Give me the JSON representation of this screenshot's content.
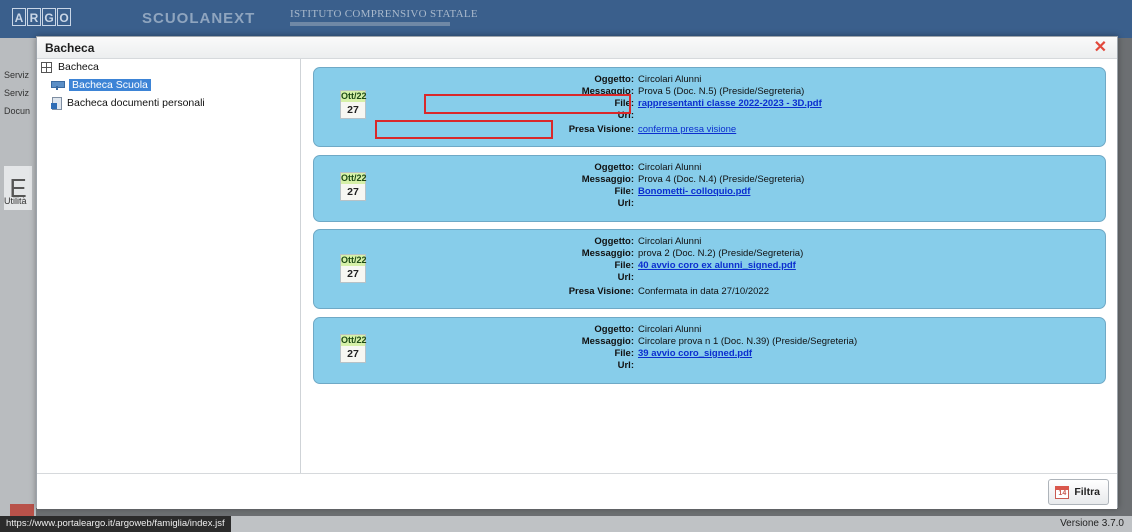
{
  "app": {
    "logo_letters": [
      "A",
      "R",
      "G",
      "O"
    ],
    "brand": "SCUOLANEXT",
    "school": "ISTITUTO COMPRENSIVO STATALE",
    "bg_menu": [
      "Serviz",
      "Serviz",
      "Docun",
      "Utilità"
    ],
    "bg_tile_letter": "E",
    "status_url": "https://www.portaleargo.it/argoweb/famiglia/index.jsf",
    "version": "Versione 3.7.0"
  },
  "modal": {
    "title": "Bacheca",
    "close_glyph": "✕",
    "tree": {
      "root": "Bacheca",
      "items": [
        "Bacheca Scuola",
        "Bacheca documenti personali"
      ]
    },
    "labels": {
      "oggetto": "Oggetto:",
      "messaggio": "Messaggio:",
      "file": "File:",
      "url": "Url:",
      "presa_visione": "Presa Visione:"
    },
    "cards": [
      {
        "month": "Ott/22",
        "day": "27",
        "oggetto": "Circolari Alunni",
        "messaggio": "Prova 5 (Doc. N.5) (Preside/Segreteria)",
        "file": "rappresentanti classe 2022-2023 - 3D.pdf",
        "url": "",
        "presa_visione": "conferma presa visione"
      },
      {
        "month": "Ott/22",
        "day": "27",
        "oggetto": "Circolari Alunni",
        "messaggio": "Prova 4 (Doc. N.4) (Preside/Segreteria)",
        "file": "Bonometti- colloquio.pdf",
        "url": ""
      },
      {
        "month": "Ott/22",
        "day": "27",
        "oggetto": "Circolari Alunni",
        "messaggio": "prova 2 (Doc. N.2) (Preside/Segreteria)",
        "file": "40 avvio coro ex alunni_signed.pdf",
        "url": "",
        "presa_visione": "Confermata in data 27/10/2022"
      },
      {
        "month": "Ott/22",
        "day": "27",
        "oggetto": "Circolari Alunni",
        "messaggio": "Circolare prova n 1 (Doc. N.39) (Preside/Segreteria)",
        "file": "39 avvio coro_signed.pdf",
        "url": ""
      }
    ],
    "filter_button": "Filtra",
    "cal_icon_text": "14"
  },
  "colors": {
    "card_bg": "#87cdea",
    "link": "#0b2ecf",
    "highlight_box": "#d9282a",
    "close": "#e2483b",
    "tree_selected": "#3d84d6"
  }
}
